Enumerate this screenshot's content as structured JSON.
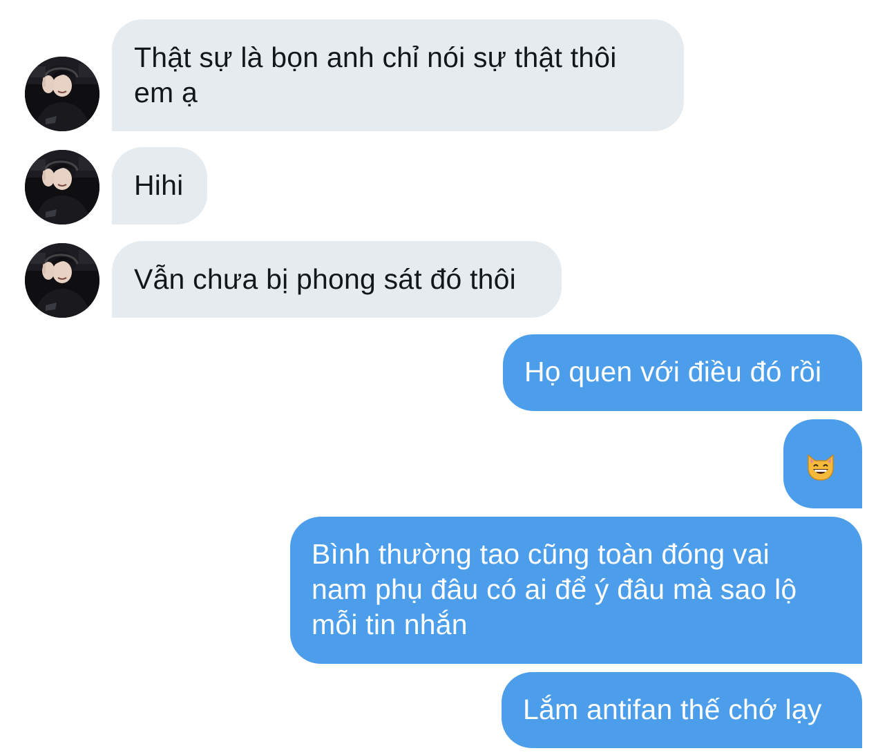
{
  "messages": [
    {
      "side": "received",
      "lines": [
        "Thật sự là bọn anh chỉ nói sự thật thôi",
        "em ạ"
      ]
    },
    {
      "side": "received",
      "lines": [
        "Hihi"
      ]
    },
    {
      "side": "received",
      "lines": [
        "Vẫn chưa bị phong sát đó thôi"
      ]
    },
    {
      "side": "sent",
      "lines": [
        "Họ quen với điều đó rồi"
      ]
    },
    {
      "side": "sent",
      "emoji": "grinning-cat-emoji"
    },
    {
      "side": "sent",
      "lines": [
        "Bình thường tao cũng toàn đóng vai",
        "nam phụ đâu có ai để ý đâu mà sao lộ",
        "mỗi tin nhắn"
      ]
    },
    {
      "side": "sent",
      "lines": [
        "Lắm antifan thế chớ lạy"
      ]
    }
  ],
  "colors": {
    "received_bubble": "#e6ebef",
    "received_text": "#14171a",
    "sent_bubble": "#4c9eea",
    "sent_text": "#ffffff"
  },
  "icons": {
    "avatar": "user-avatar-photo",
    "emoji": "grinning-cat-emoji"
  }
}
